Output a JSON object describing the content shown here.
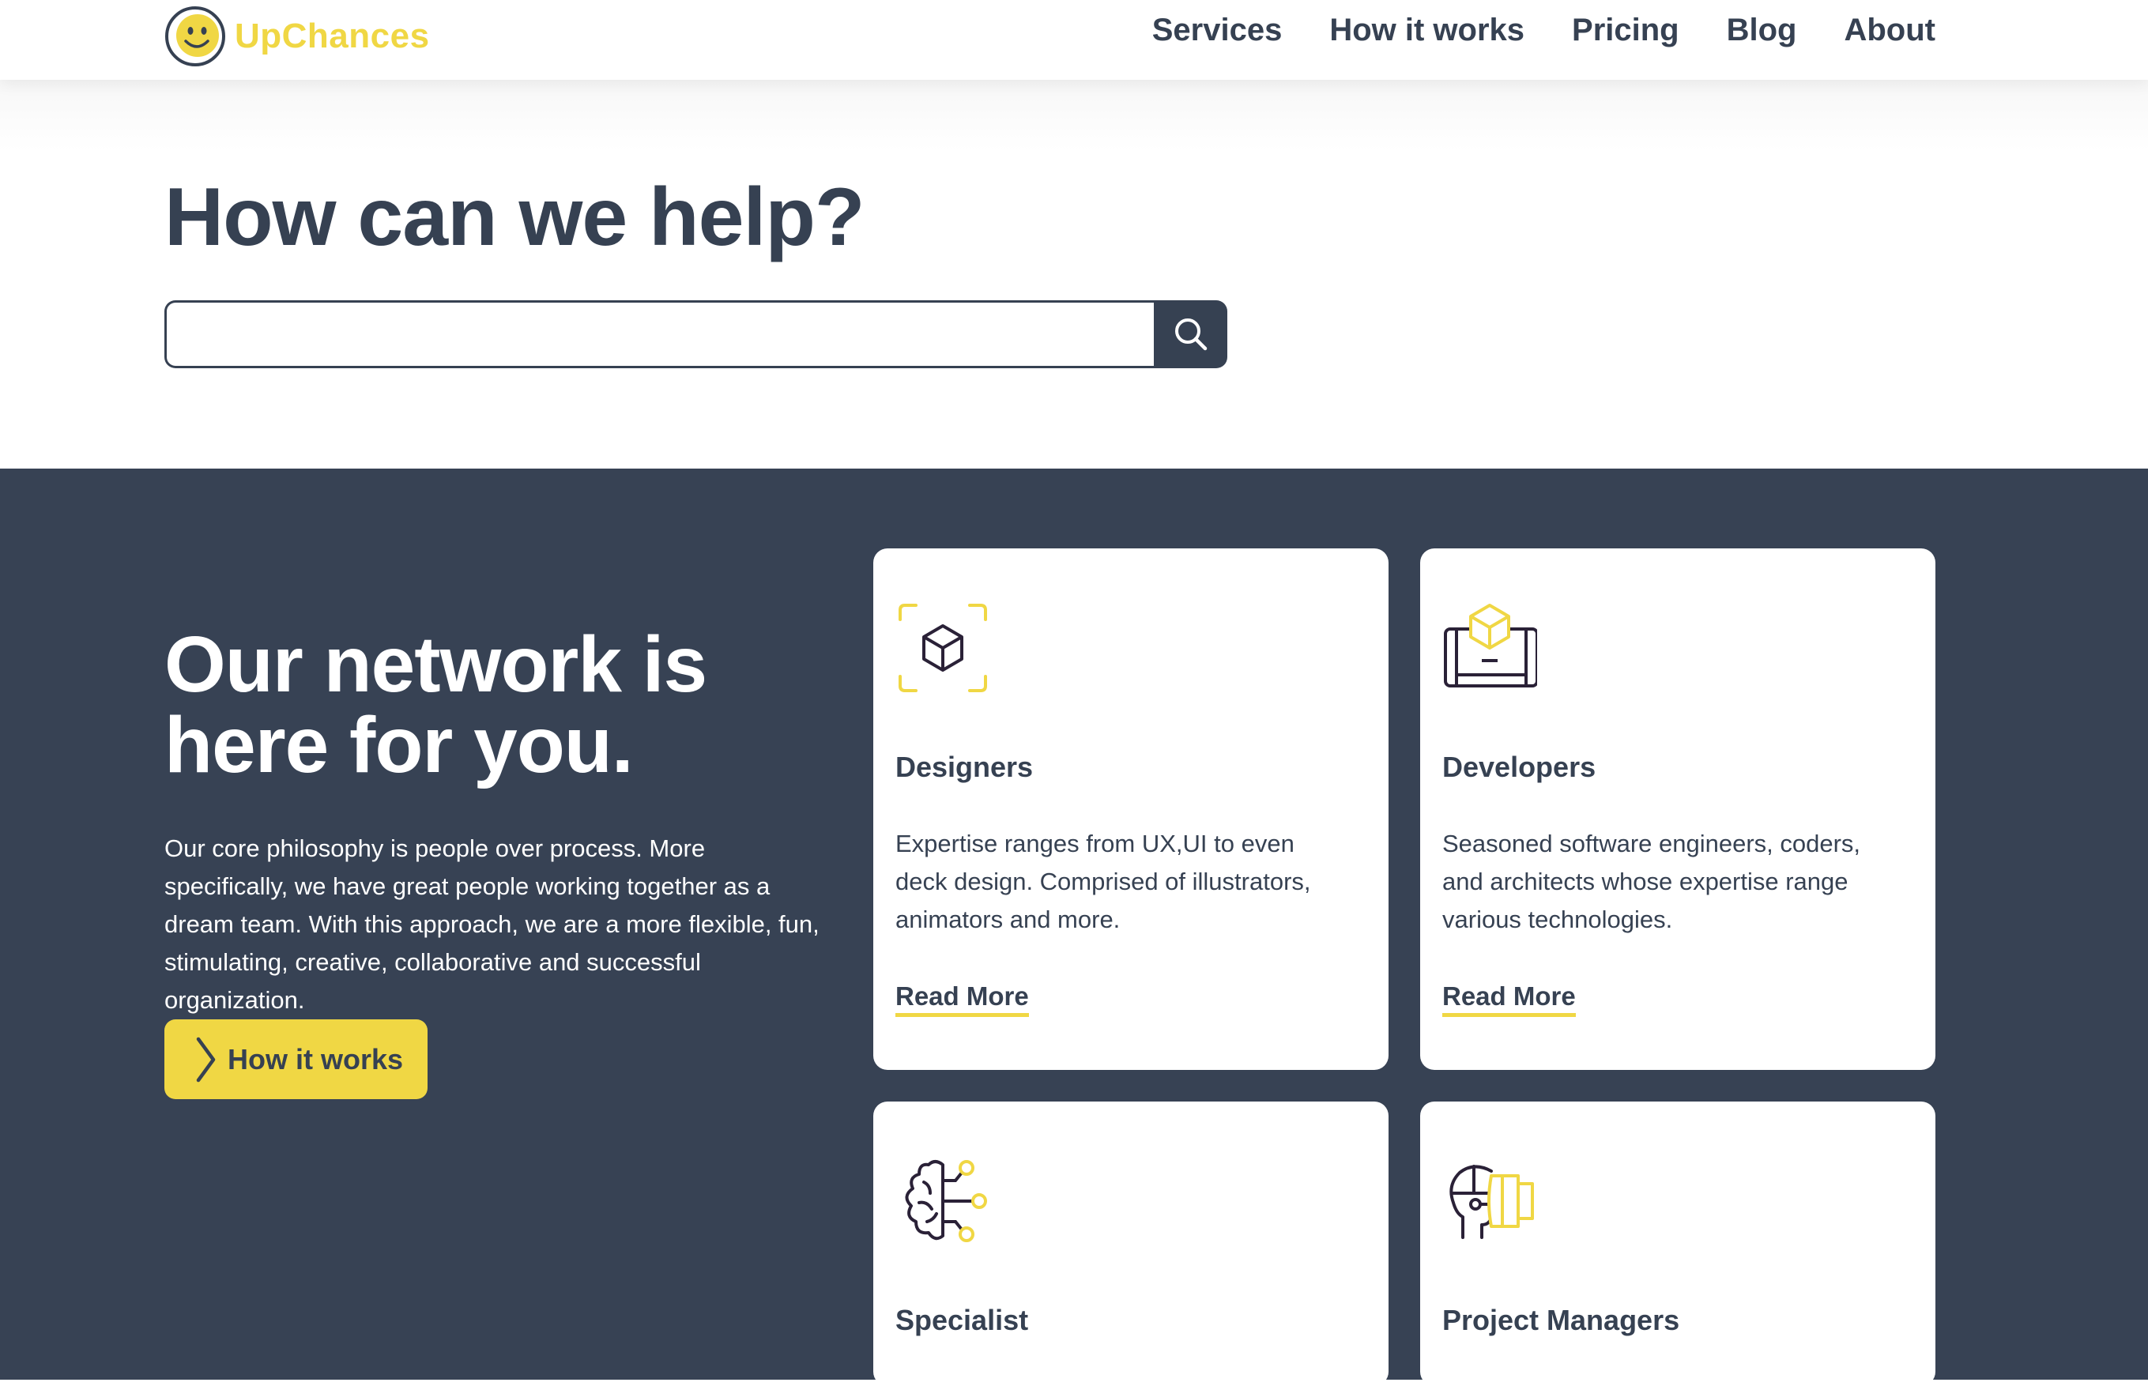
{
  "brand": {
    "name": "UpChances",
    "color": "#f0d744",
    "dark": "#364152"
  },
  "nav": {
    "items": [
      "Services",
      "How it works",
      "Pricing",
      "Blog",
      "About"
    ]
  },
  "hero": {
    "title": "How can we help?",
    "search_value": "",
    "search_icon": "magnifier-icon"
  },
  "network": {
    "title": "Our network is here for you.",
    "body": "Our core philosophy is people over process. More specifically, we have great people working together as a dream team. With this approach, we are a more flexible, fun, stimulating, creative, collaborative and successful organization.",
    "cta_label": "How it works",
    "cta_icon": "chevron-right-icon"
  },
  "cards": [
    {
      "title": "Designers",
      "icon": "design-cube-icon",
      "desc": "Expertise ranges from UX,UI to even deck design. Comprised of illustrators, animators and more.",
      "link": "Read More"
    },
    {
      "title": "Developers",
      "icon": "developer-device-icon",
      "desc": "Seasoned software engineers, coders, and architects whose expertise range various technologies.",
      "link": "Read More"
    },
    {
      "title": "Specialist",
      "icon": "brain-circuit-icon"
    },
    {
      "title": "Project Managers",
      "icon": "vr-headset-icon"
    }
  ]
}
